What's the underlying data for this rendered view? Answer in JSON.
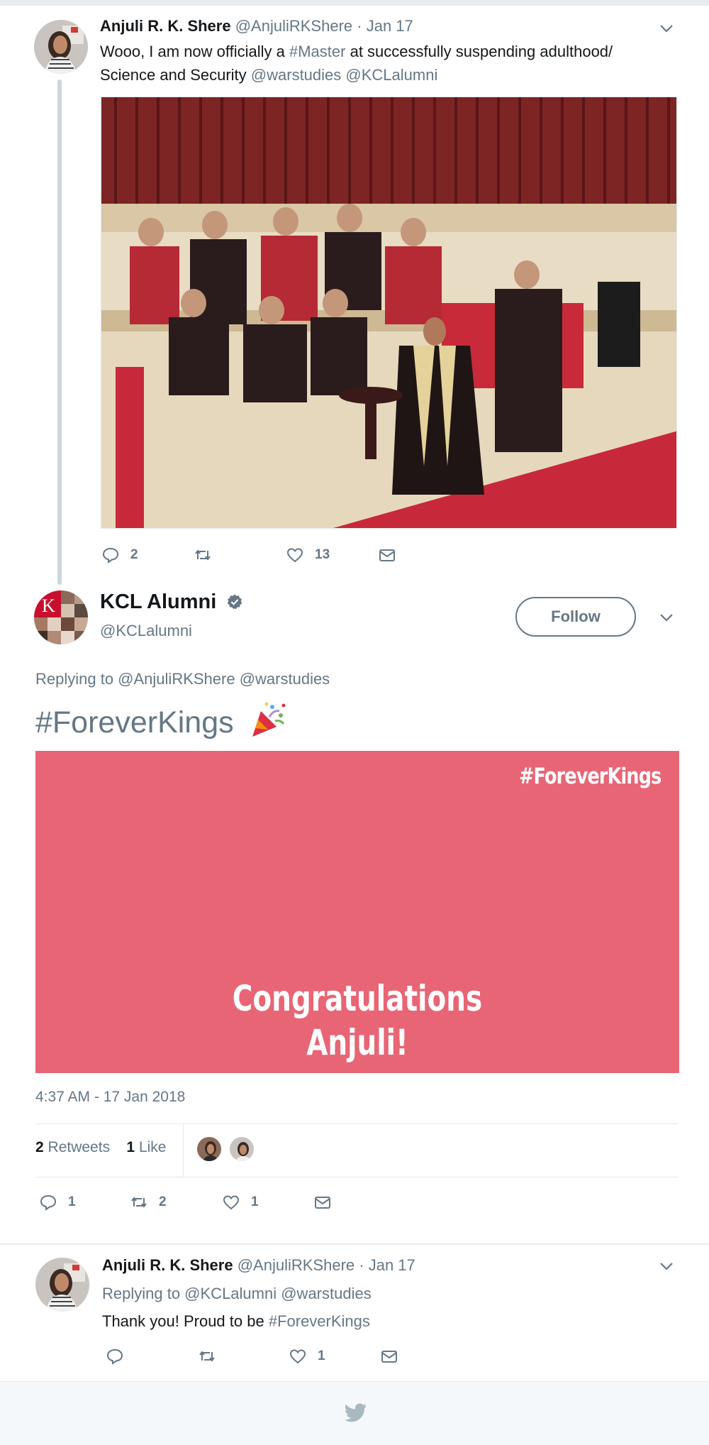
{
  "tweet1": {
    "author": "Anjuli R. K. Shere",
    "handle": "@AnjuliRKShere",
    "date": "· Jan 17",
    "text_before": "Wooo, I am now officially a ",
    "hashtag": "#Master",
    "text_after": " at successfully suspending adulthood/ Science and Security ",
    "mention1": "@warstudies",
    "mention2": "@KCLalumni",
    "replies": "2",
    "retweets": "",
    "likes": "13"
  },
  "tweet2": {
    "author": "KCL Alumni",
    "handle": "@KCLalumni",
    "follow_label": "Follow",
    "replying_to": "Replying to @AnjuliRKShere @warstudies",
    "text": "#ForeverKings",
    "card": {
      "tag": "#ForeverKings",
      "line1": "Congratulations",
      "line2": "Anjuli!",
      "color": "#e86575"
    },
    "timestamp": "4:37 AM - 17 Jan 2018",
    "stats": {
      "retweet_count": "2",
      "retweet_label": "Retweets",
      "like_count": "1",
      "like_label": "Like"
    },
    "replies": "1",
    "retweets": "2",
    "likes": "1"
  },
  "tweet3": {
    "author": "Anjuli R. K. Shere",
    "handle": "@AnjuliRKShere",
    "date": "· Jan 17",
    "replying_to": "Replying to @KCLalumni @warstudies",
    "text_before": "Thank you! Proud to be ",
    "hashtag": "#ForeverKings",
    "replies": "",
    "retweets": "",
    "likes": "1"
  },
  "colors": {
    "link": "#657786",
    "verified": "#657786",
    "card": "#e86575",
    "footer": "#f5f8fa"
  },
  "icons": [
    "reply-icon",
    "retweet-icon",
    "like-icon",
    "dm-icon",
    "chevron-down-icon",
    "verified-badge-icon",
    "twitter-bird-icon"
  ]
}
